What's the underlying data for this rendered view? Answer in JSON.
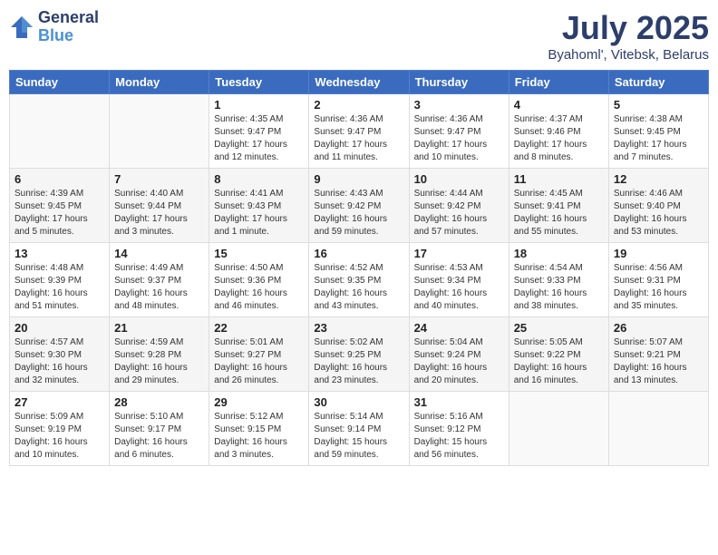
{
  "header": {
    "logo": {
      "general": "General",
      "blue": "Blue"
    },
    "title": "July 2025",
    "location": "Byahoml', Vitebsk, Belarus"
  },
  "weekdays": [
    "Sunday",
    "Monday",
    "Tuesday",
    "Wednesday",
    "Thursday",
    "Friday",
    "Saturday"
  ],
  "weeks": [
    [
      {
        "day": "",
        "info": ""
      },
      {
        "day": "",
        "info": ""
      },
      {
        "day": "1",
        "info": "Sunrise: 4:35 AM\nSunset: 9:47 PM\nDaylight: 17 hours\nand 12 minutes."
      },
      {
        "day": "2",
        "info": "Sunrise: 4:36 AM\nSunset: 9:47 PM\nDaylight: 17 hours\nand 11 minutes."
      },
      {
        "day": "3",
        "info": "Sunrise: 4:36 AM\nSunset: 9:47 PM\nDaylight: 17 hours\nand 10 minutes."
      },
      {
        "day": "4",
        "info": "Sunrise: 4:37 AM\nSunset: 9:46 PM\nDaylight: 17 hours\nand 8 minutes."
      },
      {
        "day": "5",
        "info": "Sunrise: 4:38 AM\nSunset: 9:45 PM\nDaylight: 17 hours\nand 7 minutes."
      }
    ],
    [
      {
        "day": "6",
        "info": "Sunrise: 4:39 AM\nSunset: 9:45 PM\nDaylight: 17 hours\nand 5 minutes."
      },
      {
        "day": "7",
        "info": "Sunrise: 4:40 AM\nSunset: 9:44 PM\nDaylight: 17 hours\nand 3 minutes."
      },
      {
        "day": "8",
        "info": "Sunrise: 4:41 AM\nSunset: 9:43 PM\nDaylight: 17 hours\nand 1 minute."
      },
      {
        "day": "9",
        "info": "Sunrise: 4:43 AM\nSunset: 9:42 PM\nDaylight: 16 hours\nand 59 minutes."
      },
      {
        "day": "10",
        "info": "Sunrise: 4:44 AM\nSunset: 9:42 PM\nDaylight: 16 hours\nand 57 minutes."
      },
      {
        "day": "11",
        "info": "Sunrise: 4:45 AM\nSunset: 9:41 PM\nDaylight: 16 hours\nand 55 minutes."
      },
      {
        "day": "12",
        "info": "Sunrise: 4:46 AM\nSunset: 9:40 PM\nDaylight: 16 hours\nand 53 minutes."
      }
    ],
    [
      {
        "day": "13",
        "info": "Sunrise: 4:48 AM\nSunset: 9:39 PM\nDaylight: 16 hours\nand 51 minutes."
      },
      {
        "day": "14",
        "info": "Sunrise: 4:49 AM\nSunset: 9:37 PM\nDaylight: 16 hours\nand 48 minutes."
      },
      {
        "day": "15",
        "info": "Sunrise: 4:50 AM\nSunset: 9:36 PM\nDaylight: 16 hours\nand 46 minutes."
      },
      {
        "day": "16",
        "info": "Sunrise: 4:52 AM\nSunset: 9:35 PM\nDaylight: 16 hours\nand 43 minutes."
      },
      {
        "day": "17",
        "info": "Sunrise: 4:53 AM\nSunset: 9:34 PM\nDaylight: 16 hours\nand 40 minutes."
      },
      {
        "day": "18",
        "info": "Sunrise: 4:54 AM\nSunset: 9:33 PM\nDaylight: 16 hours\nand 38 minutes."
      },
      {
        "day": "19",
        "info": "Sunrise: 4:56 AM\nSunset: 9:31 PM\nDaylight: 16 hours\nand 35 minutes."
      }
    ],
    [
      {
        "day": "20",
        "info": "Sunrise: 4:57 AM\nSunset: 9:30 PM\nDaylight: 16 hours\nand 32 minutes."
      },
      {
        "day": "21",
        "info": "Sunrise: 4:59 AM\nSunset: 9:28 PM\nDaylight: 16 hours\nand 29 minutes."
      },
      {
        "day": "22",
        "info": "Sunrise: 5:01 AM\nSunset: 9:27 PM\nDaylight: 16 hours\nand 26 minutes."
      },
      {
        "day": "23",
        "info": "Sunrise: 5:02 AM\nSunset: 9:25 PM\nDaylight: 16 hours\nand 23 minutes."
      },
      {
        "day": "24",
        "info": "Sunrise: 5:04 AM\nSunset: 9:24 PM\nDaylight: 16 hours\nand 20 minutes."
      },
      {
        "day": "25",
        "info": "Sunrise: 5:05 AM\nSunset: 9:22 PM\nDaylight: 16 hours\nand 16 minutes."
      },
      {
        "day": "26",
        "info": "Sunrise: 5:07 AM\nSunset: 9:21 PM\nDaylight: 16 hours\nand 13 minutes."
      }
    ],
    [
      {
        "day": "27",
        "info": "Sunrise: 5:09 AM\nSunset: 9:19 PM\nDaylight: 16 hours\nand 10 minutes."
      },
      {
        "day": "28",
        "info": "Sunrise: 5:10 AM\nSunset: 9:17 PM\nDaylight: 16 hours\nand 6 minutes."
      },
      {
        "day": "29",
        "info": "Sunrise: 5:12 AM\nSunset: 9:15 PM\nDaylight: 16 hours\nand 3 minutes."
      },
      {
        "day": "30",
        "info": "Sunrise: 5:14 AM\nSunset: 9:14 PM\nDaylight: 15 hours\nand 59 minutes."
      },
      {
        "day": "31",
        "info": "Sunrise: 5:16 AM\nSunset: 9:12 PM\nDaylight: 15 hours\nand 56 minutes."
      },
      {
        "day": "",
        "info": ""
      },
      {
        "day": "",
        "info": ""
      }
    ]
  ]
}
